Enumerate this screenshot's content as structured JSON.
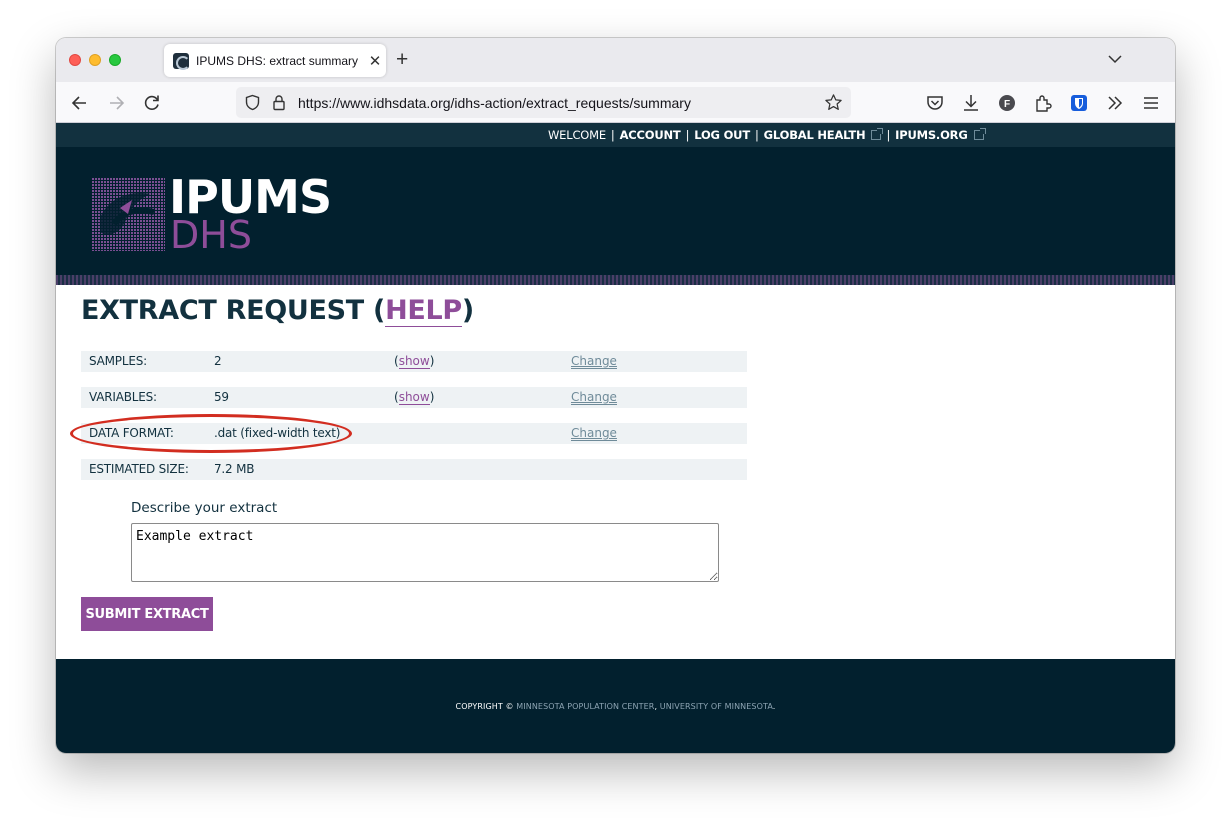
{
  "browser": {
    "tab_title": "IPUMS DHS: extract summary",
    "url": "https://www.idhsdata.org/idhs-action/extract_requests/summary"
  },
  "topnav": {
    "welcome": "WELCOME",
    "account": "ACCOUNT",
    "logout": "LOG OUT",
    "global_health": "GLOBAL HEALTH",
    "ipums_org": "IPUMS.ORG"
  },
  "logo": {
    "line1": "IPUMS",
    "line2": "DHS"
  },
  "heading": {
    "prefix": "EXTRACT REQUEST (",
    "help": "HELP",
    "suffix": ")"
  },
  "summary": {
    "rows": [
      {
        "label": "SAMPLES:",
        "value": "2",
        "show": "show",
        "change": "Change"
      },
      {
        "label": "VARIABLES:",
        "value": "59",
        "show": "show",
        "change": "Change"
      },
      {
        "label": "DATA FORMAT:",
        "value": ".dat (fixed-width text)",
        "change": "Change"
      },
      {
        "label": "ESTIMATED SIZE:",
        "value": "7.2 MB"
      }
    ]
  },
  "describe": {
    "label": "Describe your extract",
    "value": "Example extract"
  },
  "submit_label": "SUBMIT EXTRACT",
  "footer": {
    "copyright": "COPYRIGHT ©",
    "mpc": "MINNESOTA POPULATION CENTER",
    "comma": ",",
    "umn": "UNIVERSITY OF MINNESOTA",
    "period": "."
  },
  "colors": {
    "navy": "#02202e",
    "topnav": "#12313f",
    "purple": "#8e4d99",
    "row_bg": "#eef2f4",
    "highlight": "#d22d20"
  }
}
